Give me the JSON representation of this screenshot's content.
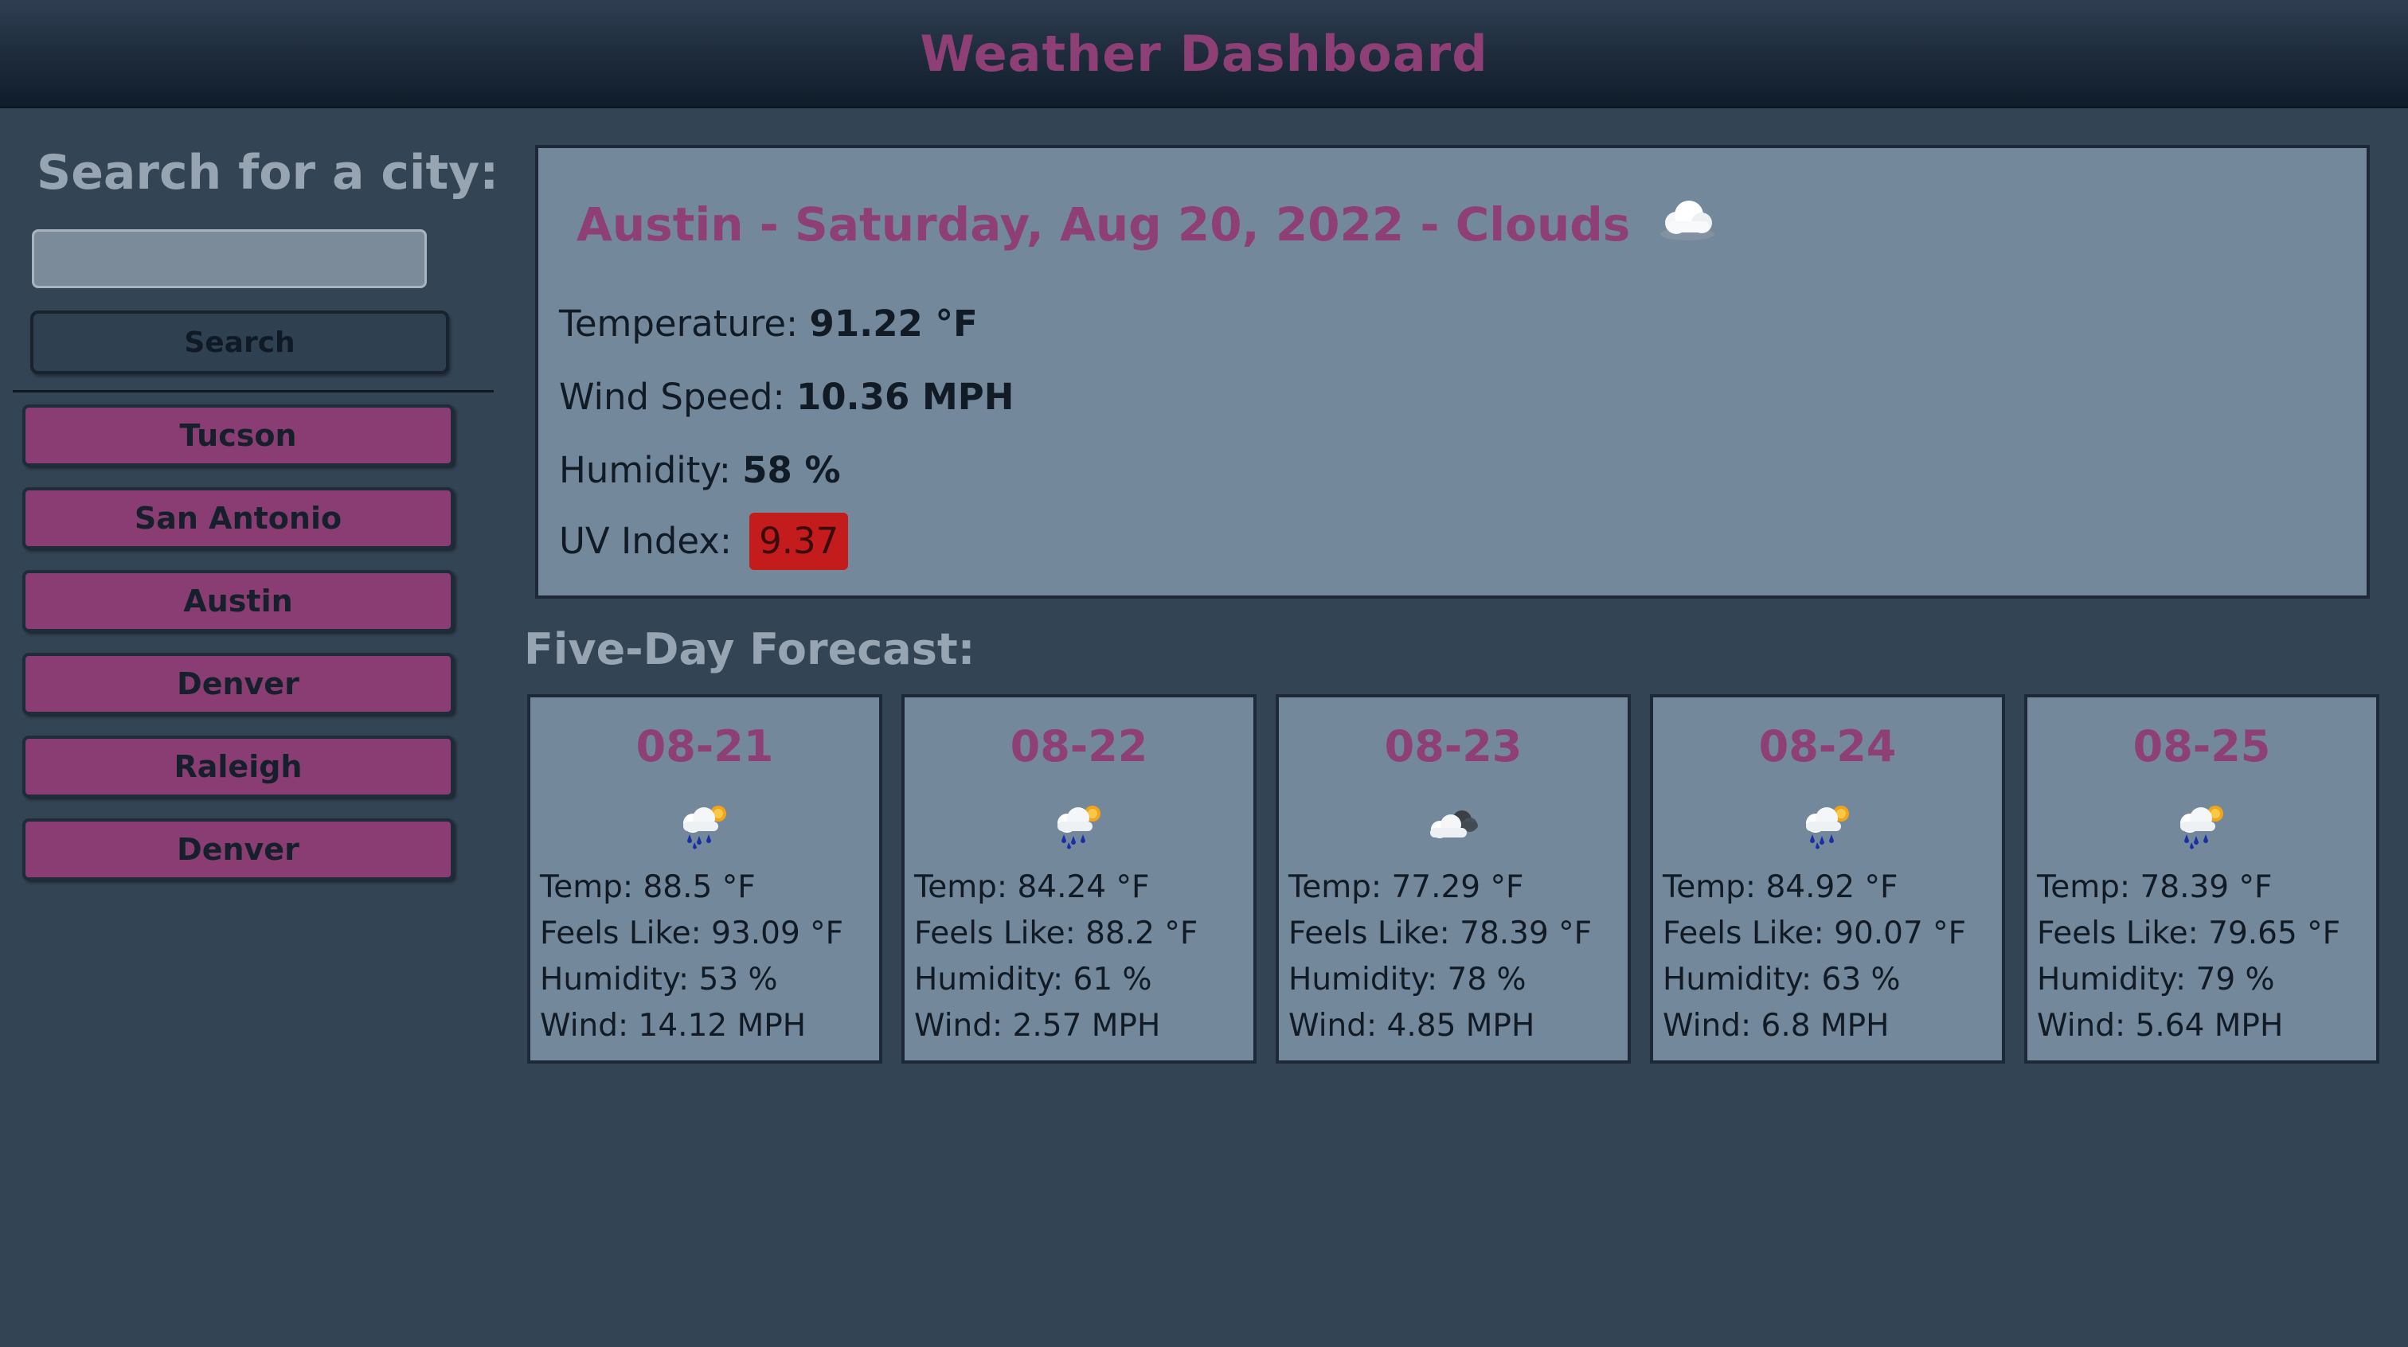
{
  "header": {
    "title": "Weather Dashboard"
  },
  "sidebar": {
    "heading": "Search for a city:",
    "search_value": "",
    "search_button": "Search",
    "history": [
      "Tucson",
      "San Antonio",
      "Austin",
      "Denver",
      "Raleigh",
      "Denver"
    ]
  },
  "current": {
    "title": "Austin - Saturday, Aug 20, 2022 - Clouds",
    "icon": "cloud-icon",
    "temperature_label": "Temperature:",
    "temperature": "91.22 °F",
    "wind_label": "Wind Speed:",
    "wind": "10.36 MPH",
    "humidity_label": "Humidity:",
    "humidity": "58 %",
    "uv_label": "UV Index:",
    "uv": "9.37",
    "uv_color": "#c41c1c"
  },
  "forecast": {
    "heading": "Five-Day Forecast:",
    "days": [
      {
        "date": "08-21",
        "icon": "rain-sun-icon",
        "temp": "Temp: 88.5 °F",
        "feels": "Feels Like: 93.09 °F",
        "humidity": "Humidity: 53 %",
        "wind": "Wind: 14.12 MPH"
      },
      {
        "date": "08-22",
        "icon": "rain-sun-icon",
        "temp": "Temp: 84.24 °F",
        "feels": "Feels Like: 88.2 °F",
        "humidity": "Humidity: 61 %",
        "wind": "Wind: 2.57 MPH"
      },
      {
        "date": "08-23",
        "icon": "broken-clouds-icon",
        "temp": "Temp: 77.29 °F",
        "feels": "Feels Like: 78.39 °F",
        "humidity": "Humidity: 78 %",
        "wind": "Wind: 4.85 MPH"
      },
      {
        "date": "08-24",
        "icon": "rain-sun-icon",
        "temp": "Temp: 84.92 °F",
        "feels": "Feels Like: 90.07 °F",
        "humidity": "Humidity: 63 %",
        "wind": "Wind: 6.8 MPH"
      },
      {
        "date": "08-25",
        "icon": "rain-sun-icon",
        "temp": "Temp: 78.39 °F",
        "feels": "Feels Like: 79.65 °F",
        "humidity": "Humidity: 79 %",
        "wind": "Wind: 5.64 MPH"
      }
    ]
  },
  "colors": {
    "accent": "#8d3f76",
    "background": "#334455",
    "card": "#74889b"
  }
}
